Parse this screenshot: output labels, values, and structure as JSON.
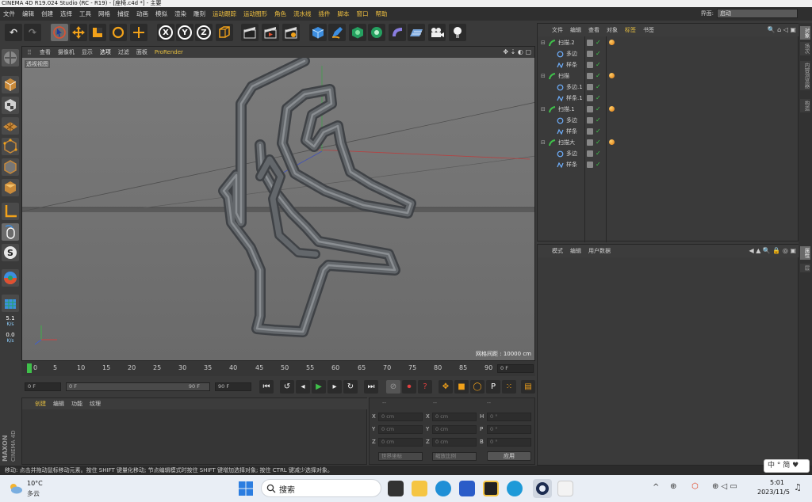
{
  "window": {
    "title": "CINEMA 4D R19.024 Studio (RC - R19) - [座椅.c4d *] - 主要"
  },
  "menubar": {
    "items": [
      "文件",
      "编辑",
      "创建",
      "选择",
      "工具",
      "网格",
      "捕捉",
      "动画",
      "模拟",
      "渲染",
      "雕刻",
      "运动跟踪",
      "运动图形",
      "角色",
      "流水线",
      "插件",
      "脚本",
      "窗口",
      "帮助"
    ],
    "layout_label": "界面:",
    "layout_value": "启动"
  },
  "toolbar": {
    "axis_x": "X",
    "axis_y": "Y",
    "axis_z": "Z"
  },
  "viewport": {
    "menu": [
      "查看",
      "摄像机",
      "显示",
      "选项",
      "过滤",
      "面板",
      "ProRender"
    ],
    "view_label": "透视视图",
    "grid_label": "网格间距 : 10000 cm"
  },
  "timeline": {
    "ticks": [
      "0",
      "5",
      "10",
      "15",
      "20",
      "25",
      "30",
      "35",
      "40",
      "45",
      "50",
      "55",
      "60",
      "65",
      "70",
      "75",
      "80",
      "85",
      "90"
    ],
    "current_frame": "0 F"
  },
  "transport": {
    "start_field": "0 F",
    "range_start": "0 F",
    "range_end": "90 F",
    "end_field": "90 F"
  },
  "left_tools": {
    "fps_value": "5.1",
    "fps_unit": "K/s",
    "speed_value": "0.0",
    "speed_unit": "K/s"
  },
  "material_panel": {
    "menu": [
      "创建",
      "编辑",
      "功能",
      "纹理"
    ]
  },
  "coords": {
    "headers": [
      "--",
      "--",
      "--"
    ],
    "rows": [
      {
        "a": "X",
        "av": "0 cm",
        "b": "X",
        "bv": "0 cm",
        "c": "H",
        "cv": "0 °"
      },
      {
        "a": "Y",
        "av": "0 cm",
        "b": "Y",
        "bv": "0 cm",
        "c": "P",
        "cv": "0 °"
      },
      {
        "a": "Z",
        "av": "0 cm",
        "b": "Z",
        "bv": "0 cm",
        "c": "B",
        "cv": "0 °"
      }
    ],
    "coord_mode": "世界坐标",
    "scale_mode": "缩放比例",
    "apply_label": "应用"
  },
  "object_manager": {
    "menu": [
      "文件",
      "编辑",
      "查看",
      "对象",
      "标签",
      "书签"
    ],
    "objects": [
      {
        "name": "扫描.2",
        "level": 0,
        "type": "sweep"
      },
      {
        "name": "多边",
        "level": 1,
        "type": "circle"
      },
      {
        "name": "样条",
        "level": 1,
        "type": "spline"
      },
      {
        "name": "扫描",
        "level": 0,
        "type": "sweep"
      },
      {
        "name": "多边.1",
        "level": 1,
        "type": "circle"
      },
      {
        "name": "样条.1",
        "level": 1,
        "type": "spline"
      },
      {
        "name": "扫描.1",
        "level": 0,
        "type": "sweep"
      },
      {
        "name": "多边",
        "level": 1,
        "type": "circle"
      },
      {
        "name": "样条",
        "level": 1,
        "type": "spline"
      },
      {
        "name": "扫描大",
        "level": 0,
        "type": "sweep"
      },
      {
        "name": "多边",
        "level": 1,
        "type": "circle"
      },
      {
        "name": "样条",
        "level": 1,
        "type": "spline"
      }
    ]
  },
  "attribute_manager": {
    "menu": [
      "模式",
      "编辑",
      "用户数据"
    ]
  },
  "right_tabs": [
    "对象",
    "场次",
    "内容浏览器",
    "构造",
    "属性",
    "层"
  ],
  "statusbar": {
    "text": "移动: 点击并拖动鼠标移动元素。按住 SHIFT 键量化移动; 节点编辑模式时按住 SHIFT 键增加选择对象; 按住 CTRL 键减少选择对象。"
  },
  "ime": {
    "text": "中 ° 简 ♥"
  },
  "taskbar": {
    "weather_temp": "10°C",
    "weather_desc": "多云",
    "search_placeholder": "搜索",
    "time": "5:01",
    "date": "2023/11/5"
  },
  "colors": {
    "accent": "#e8c040",
    "viewport_bg": "#6f6f6f",
    "panel_bg": "#3a3a3a",
    "model": "#5f6265"
  }
}
